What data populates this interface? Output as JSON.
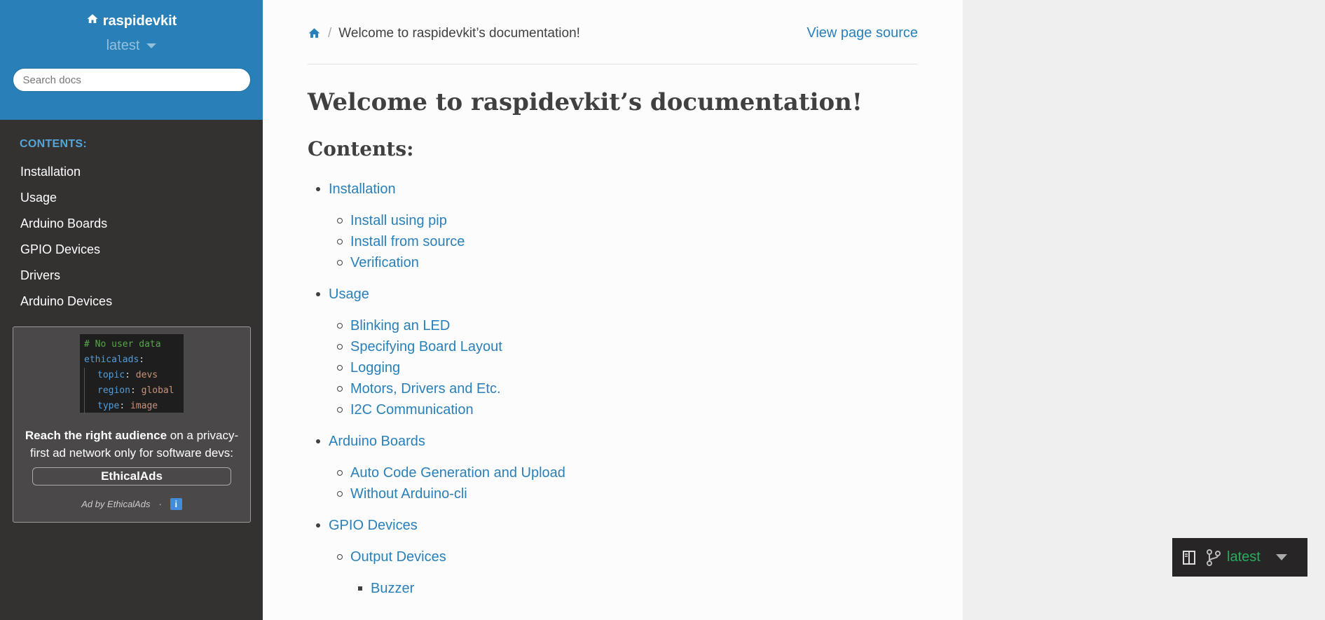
{
  "sidebar": {
    "brand": "raspidevkit",
    "version": "latest",
    "search_placeholder": "Search docs",
    "caption": "CONTENTS:",
    "items": [
      "Installation",
      "Usage",
      "Arduino Boards",
      "GPIO Devices",
      "Drivers",
      "Arduino Devices"
    ]
  },
  "ad": {
    "code": {
      "comment": "# No user data",
      "root_key": "ethicalads",
      "lines": [
        {
          "key": "topic",
          "value": "devs"
        },
        {
          "key": "region",
          "value": "global"
        },
        {
          "key": "type",
          "value": "image"
        }
      ]
    },
    "text_bold": "Reach the right audience",
    "text_rest": " on a privacy-first ad network only for software devs:",
    "button": "EthicalAds",
    "attribution": "Ad by EthicalAds",
    "dot": "·",
    "info": "i"
  },
  "breadcrumbs": {
    "separator": "/",
    "current": "Welcome to raspidevkit’s documentation!",
    "view_source": "View page source"
  },
  "main": {
    "title": "Welcome to raspidevkit’s documentation!",
    "subtitle": "Contents:",
    "toc": [
      {
        "label": "Installation",
        "children": [
          {
            "label": "Install using pip"
          },
          {
            "label": "Install from source"
          },
          {
            "label": "Verification"
          }
        ]
      },
      {
        "label": "Usage",
        "children": [
          {
            "label": "Blinking an LED"
          },
          {
            "label": "Specifying Board Layout"
          },
          {
            "label": "Logging"
          },
          {
            "label": "Motors, Drivers and Etc."
          },
          {
            "label": "I2C Communication"
          }
        ]
      },
      {
        "label": "Arduino Boards",
        "children": [
          {
            "label": "Auto Code Generation and Upload"
          },
          {
            "label": "Without Arduino-cli"
          }
        ]
      },
      {
        "label": "GPIO Devices",
        "children": [
          {
            "label": "Output Devices",
            "children": [
              {
                "label": "Buzzer"
              }
            ]
          }
        ]
      }
    ]
  },
  "version_badge": {
    "version": "latest"
  },
  "colors": {
    "accent": "#2980b9",
    "sidebar_bg": "#343131",
    "badge_green": "#27ae60"
  }
}
